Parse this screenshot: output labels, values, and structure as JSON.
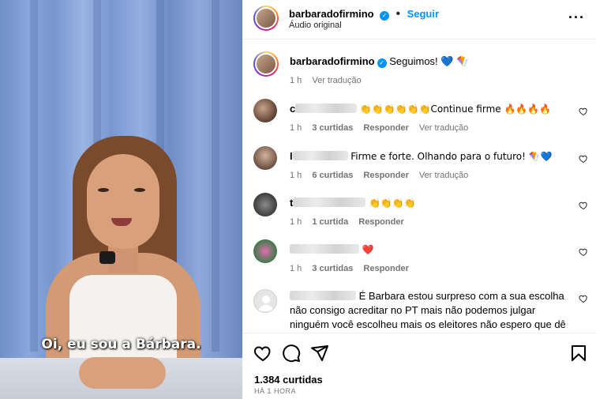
{
  "video": {
    "subtitle": "Oi, eu sou a Bárbara."
  },
  "header": {
    "username": "barbaradofirmino",
    "follow_label": "Seguir",
    "audio_label": "Áudio original"
  },
  "caption": {
    "username": "barbaradofirmino",
    "text": "Seguimos! 💙 🪁",
    "time": "1 h",
    "translate_label": "Ver tradução"
  },
  "comments": [
    {
      "visible_user": "c",
      "text": "👏👏👏👏👏👏Continue firme 🔥🔥🔥🔥",
      "time": "1 h",
      "likes": "3 curtidas",
      "reply": "Responder",
      "translate": "Ver tradução"
    },
    {
      "visible_user": "I",
      "text": "Firme e forte. Olhando para o futuro! 🪁💙",
      "time": "1 h",
      "likes": "6 curtidas",
      "reply": "Responder",
      "translate": "Ver tradução"
    },
    {
      "visible_user": "t",
      "text": "👏👏👏👏",
      "time": "1 h",
      "likes": "1 curtida",
      "reply": "Responder"
    },
    {
      "visible_user": "",
      "text": "❤️",
      "time": "1 h",
      "likes": "3 curtidas",
      "reply": "Responder"
    },
    {
      "visible_user": "",
      "text": "É Barbara estou surpreso com a sua escolha não consigo acreditar no PT mais não podemos julgar ninguém você escolheu mais os eleitores não espero que dê"
    }
  ],
  "actions": {
    "icons": [
      "heart-icon",
      "comment-icon",
      "share-icon",
      "bookmark-icon"
    ]
  },
  "stats": {
    "likes": "1.384 curtidas",
    "posted": "HÁ 1 HORA"
  },
  "colors": {
    "link_blue": "#0095f6",
    "secondary_text": "#737373"
  }
}
